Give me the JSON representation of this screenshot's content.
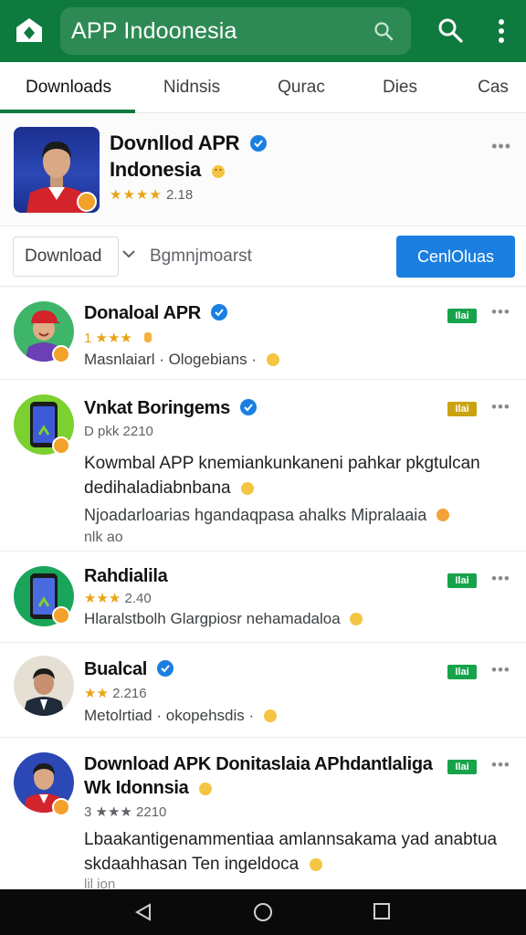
{
  "appbar": {
    "search_query": "APP Indoonesia",
    "logo_icon": "store-logo-icon",
    "search_icon": "search-icon",
    "more_icon": "more-vert-icon",
    "accent": "#0f7a3d"
  },
  "tabs": [
    {
      "label": "Downloads",
      "active": true
    },
    {
      "label": "Nidnsis"
    },
    {
      "label": "Qurac"
    },
    {
      "label": "Dies"
    },
    {
      "label": "Cas"
    }
  ],
  "featured": {
    "title_line1": "Dovnllod APR",
    "title_line2": "Indonesia",
    "stars": "★★★★",
    "rating_text": "2.18",
    "more": "•••"
  },
  "actions": {
    "download_select": "Download",
    "label": "Bgmnjmoarst",
    "primary_button": "CenlOluas",
    "primary_color": "#1a7fe0"
  },
  "items": [
    {
      "title": "Donaloal APR",
      "stars": "1 ★★★",
      "meta": "Masnlaiarl · Ologebians ·",
      "tag": "Ilai",
      "tag_color": "green",
      "more": "•••"
    },
    {
      "title": "Vnkat Boringems",
      "rating": "D pkk 2210",
      "desc": "Kowmbal APP knemiankunkaneni pahkar pkgtulcan dedihaladiabnbana",
      "desc2": "Njoadarloarias hgandaqpasa ahalks Mipralaaia",
      "desc3": "nlk ao",
      "tag": "Ilai",
      "tag_color": "yellow",
      "more": "•••"
    },
    {
      "title": "Rahdialila",
      "stars": "★★★",
      "rating_text": "2.40",
      "meta": "Hlaralstbolh Glargpiosr nehamadaloa",
      "tag": "Ilai",
      "tag_color": "green",
      "more": "•••"
    },
    {
      "title": "Bualcal",
      "stars": "★★",
      "rating_text": "2.216",
      "meta": "Metolrtiad · okopehsdis ·",
      "tag": "Ilai",
      "tag_color": "green",
      "more": "•••"
    },
    {
      "title": "Download APK Donitaslaia APhdantlaliga",
      "title2": "Wk Idonnsia",
      "rating": "3 ★★★ 2210",
      "desc": "Lbaakantigenammentiaa amlannsakama yad anabtua",
      "desc2": "skdaahhasan Ten ingeldoca",
      "desc3": "lil ion",
      "tag": "Ilai",
      "tag_color": "green",
      "more": "•••"
    }
  ],
  "navbar": {
    "back_icon": "back-icon",
    "home_icon": "home-icon",
    "recents_icon": "recents-icon"
  }
}
